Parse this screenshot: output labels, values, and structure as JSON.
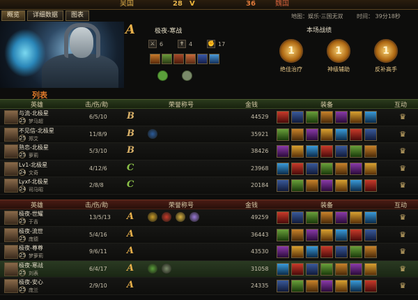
{
  "top": {
    "wei": "吴国",
    "wei_score": "28",
    "shu": "魏国",
    "shu_score": "36"
  },
  "tabs": [
    "概览",
    "详细数据",
    "图表"
  ],
  "map_info": "地图：娱乐·三国无双",
  "time_info": "时间： 39分18秒",
  "player": {
    "grade": "A",
    "name": "极夜-寒战",
    "kills": "6",
    "deaths": "4",
    "assists": "17"
  },
  "stats_panel": {
    "title": "本场战绩",
    "medals": [
      {
        "num": "1",
        "label": "绝佳治疗"
      },
      {
        "num": "1",
        "label": "神级辅助"
      },
      {
        "num": "1",
        "label": "反补高手"
      }
    ]
  },
  "section_label": "列表",
  "header": {
    "hero": "英雄",
    "kda": "击/伤/助",
    "honor": "荣誉称号",
    "gold": "金钱",
    "equip": "装备",
    "interact": "互动"
  },
  "team1": [
    {
      "name": "与流-北极星",
      "level": "25",
      "hero": "梦马超",
      "kda": "6/5/10",
      "grade": "B",
      "gold": "44529",
      "honors": []
    },
    {
      "name": "不见信-北极星",
      "level": "25",
      "hero": "郑艾",
      "kda": "11/8/9",
      "grade": "B",
      "gold": "35921",
      "honors": [
        "#2a5a9a"
      ]
    },
    {
      "name": "熟恋-北极星",
      "level": "25",
      "hero": "萝莉",
      "kda": "5/3/10",
      "grade": "B",
      "gold": "38426",
      "honors": []
    },
    {
      "name": "Lv1-北极星",
      "level": "24",
      "hero": "文奇",
      "kda": "4/12/6",
      "grade": "C",
      "gold": "23968",
      "honors": []
    },
    {
      "name": "Lyxf-北极星",
      "level": "24",
      "hero": "司马昭",
      "kda": "2/8/8",
      "grade": "C",
      "gold": "20184",
      "honors": []
    }
  ],
  "team2": [
    {
      "name": "极夜-世耀",
      "level": "25",
      "hero": "于吉",
      "kda": "13/5/13",
      "grade": "A",
      "gold": "49259",
      "honors": [
        "#c89a28",
        "#c83a2a",
        "#d8b040",
        "#9a7ad8"
      ]
    },
    {
      "name": "极夜-流世",
      "level": "25",
      "hero": "庞德",
      "kda": "5/4/16",
      "grade": "A",
      "gold": "36443",
      "honors": []
    },
    {
      "name": "极夜-尊尊",
      "level": "25",
      "hero": "梦萝莉",
      "kda": "9/6/11",
      "grade": "A",
      "gold": "43530",
      "honors": []
    },
    {
      "name": "极夜-寒战",
      "level": "25",
      "hero": "刘表",
      "kda": "6/4/17",
      "grade": "A",
      "gold": "31058",
      "honors": [
        "#5aa03a",
        "#7a8a6a"
      ],
      "highlight": true
    },
    {
      "name": "极夜-安心",
      "level": "25",
      "hero": "庞兰",
      "kda": "2/9/10",
      "grade": "A",
      "gold": "24335",
      "honors": []
    }
  ],
  "colors": {
    "grade_A": "#e8b04a",
    "grade_B": "#d8b068",
    "grade_C": "#8ac048",
    "accent": "#e07a2a"
  }
}
